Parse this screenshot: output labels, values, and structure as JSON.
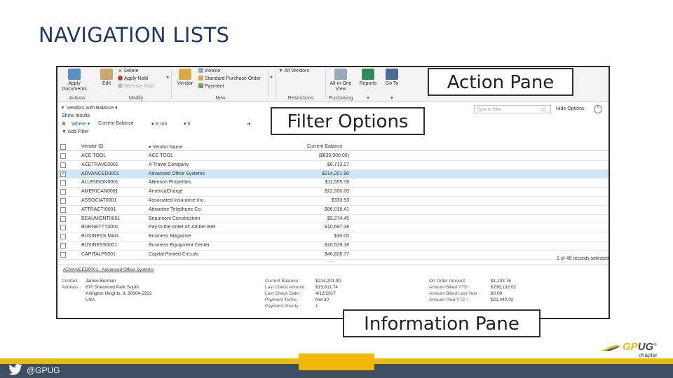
{
  "slide": {
    "title": "NAVIGATION LISTS",
    "twitter_handle": "@GPUG",
    "logo": {
      "main_prefix": "GP",
      "main_suffix": "UG",
      "reg": "®",
      "sub": "chapter"
    },
    "colors": {
      "title": "#1f3864",
      "footer": "#3d4e63",
      "accent": "#f2b705"
    }
  },
  "callouts": {
    "action_pane": "Action Pane",
    "filter_options": "Filter Options",
    "information_pane": "Information Pane"
  },
  "ribbon": {
    "apply_documents": "Apply Documents",
    "edit": "Edit",
    "delete": "Delete",
    "apply_hold": "Apply Hold",
    "remove_hold": "Remove Hold",
    "actions_label": "Actions",
    "modify_label": "Modify",
    "vendor": "Vendor",
    "invoice": "Invoice",
    "standard_purchase_order": "Standard Purchase Order",
    "payment": "Payment",
    "new_label": "New",
    "all_vendors": "All Vendors",
    "restrictions_label": "Restrictions",
    "all_in_one_view": "All-in-One View",
    "purchasing_label": "Purchasing",
    "reports": "Reports",
    "go_to": "Go To"
  },
  "filter": {
    "list_title": "Vendors with Balance",
    "show_results": "Show results",
    "where": "Where",
    "field": "Current Balance",
    "operator": "is not",
    "value": "0",
    "add_filter": "Add Filter",
    "search_placeholder": "Type to filter",
    "hide_options": "Hide Options"
  },
  "grid": {
    "columns": [
      "Vendor ID",
      "Vendor Name",
      "Current Balance"
    ],
    "rows": [
      {
        "id": "ACE TOOL",
        "name": "ACE TOOL",
        "balance": "($839,900.00)",
        "checked": ""
      },
      {
        "id": "ACETRAVE0001",
        "name": "A Travel Company",
        "balance": "$6,713.27",
        "checked": ""
      },
      {
        "id": "ADVANCED0001",
        "name": "Advanced Office Systems",
        "balance": "$214,201.90",
        "checked": "✓"
      },
      {
        "id": "ALLENSON0001",
        "name": "Allenson Properties",
        "balance": "$11,555.78",
        "checked": ""
      },
      {
        "id": "AMERICAN0001",
        "name": "AmericaCharge",
        "balance": "$22,500.00",
        "checked": ""
      },
      {
        "id": "ASSOCIAT0001",
        "name": "Associated Insurance Inc.",
        "balance": "$333.93",
        "checked": ""
      },
      {
        "id": "ATTRACTI0001",
        "name": "Attractive Telephone Co.",
        "balance": "$86,016.41",
        "checked": ""
      },
      {
        "id": "BEAUMONT0001",
        "name": "Beaumont Construction",
        "balance": "$9,274.45",
        "checked": ""
      },
      {
        "id": "BURNETTT0001",
        "name": "Pay to the order of: Amber Bell",
        "balance": "$10,697.38",
        "checked": ""
      },
      {
        "id": "BUSINESS MAG",
        "name": "Business Magazine",
        "balance": "$30.00",
        "checked": ""
      },
      {
        "id": "BUSINESS0001",
        "name": "Business Equipment Center",
        "balance": "$10,529.18",
        "checked": ""
      },
      {
        "id": "CAPITALP0001",
        "name": "Capital Printed Circuits",
        "balance": "$46,826.77",
        "checked": ""
      }
    ],
    "records_selected": "1 of 49 records selected"
  },
  "info": {
    "link": "ADVANCED0001 : Advanced Office Systems",
    "contact_label": "Contact :",
    "contact": "Janice Berman",
    "address_label": "Address :",
    "address_lines": [
      "670 Sherwood Park South",
      "Arlington Heights, IL 60004-2922",
      "USA"
    ],
    "mid_labels": [
      "Current Balance :",
      "Last Check Amount :",
      "Last Check Date :",
      "Payment Terms :",
      "Payment Priority :"
    ],
    "mid_values": [
      "$214,201.90",
      "$15,811.74",
      "4/12/2017",
      "Net 30",
      "1"
    ],
    "right_labels": [
      "On Order Amount :",
      "Amount Billed YTD :",
      "Amount Billed Last Year :",
      "Amount Paid YTD :"
    ],
    "right_values": [
      "$1,103.76",
      "$236,132.02",
      "$0.00",
      "$21,440.02"
    ]
  }
}
